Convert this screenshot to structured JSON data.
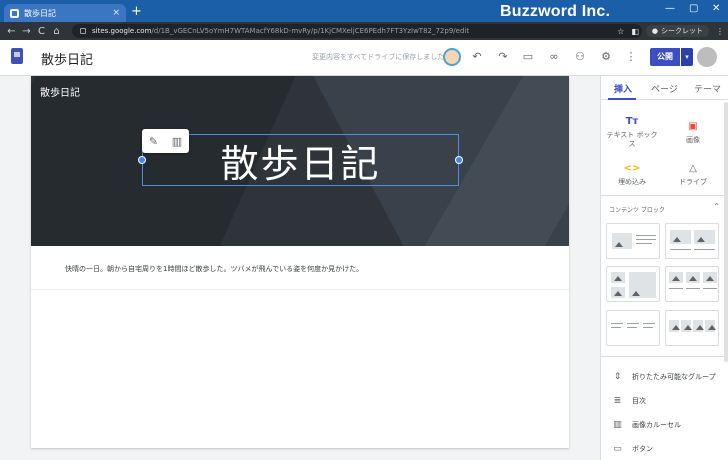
{
  "browser": {
    "tab_title": "散歩日記",
    "tab_close": "×",
    "new_tab": "+",
    "brand": "Buzzword Inc.",
    "window_controls": [
      "—",
      "▢",
      "✕"
    ],
    "nav": [
      "←",
      "→",
      "C",
      "⌂"
    ],
    "url_host": "sites.google.com",
    "url_path": "/d/1B_vGECnLV5oYmH7WTAMacfY68kD-mvRy/p/1KjCMXeljCE6PEdh7FT3YzIwT82_72p9/edit",
    "incognito_label": "シークレット",
    "menu": "⋮"
  },
  "sites_header": {
    "site_name": "散歩日記",
    "save_status": "変更内容をすべてドライブに保存しました",
    "publish_label": "公開",
    "publish_arrow": "▾",
    "icons": [
      "account-face-icon",
      "undo-icon",
      "redo-icon",
      "device-preview-icon",
      "link-icon",
      "share-icon",
      "settings-icon",
      "more-icon"
    ]
  },
  "canvas": {
    "hero_site_name": "散歩日記",
    "title": "散歩日記",
    "body_text": "快晴の一日。朝から自宅周りを1時間ほど散歩した。ツバメが飛んでいる姿を何度か見かけた。",
    "edit_icon": "✎",
    "delete_icon": "🗑"
  },
  "panel": {
    "tabs": [
      "挿入",
      "ページ",
      "テーマ"
    ],
    "active_tab": "挿入",
    "insert_items": [
      {
        "label": "テキスト ボック ス",
        "icon": "Tт",
        "color": "#3b4fc4"
      },
      {
        "label": "画像",
        "icon": "▣",
        "color": "#e84c3d"
      },
      {
        "label": "埋め込み",
        "icon": "<>",
        "color": "#f4b400"
      },
      {
        "label": "ドライブ",
        "icon": "△",
        "color": "#5f6368"
      }
    ],
    "section_title": "コンテンツ ブロック",
    "section_chevron": "⌃",
    "list_items": [
      {
        "label": "折りたたみ可能なグループ",
        "icon": "⇕"
      },
      {
        "label": "目次",
        "icon": "≣"
      },
      {
        "label": "画像カルーセル",
        "icon": "▥"
      },
      {
        "label": "ボタン",
        "icon": "▭"
      }
    ]
  },
  "colors": {
    "accent": "#3b4fc4",
    "chrome_tabbar": "#1b5fa8",
    "hero_bg": "#2e3439",
    "selection": "#4a90e2"
  }
}
